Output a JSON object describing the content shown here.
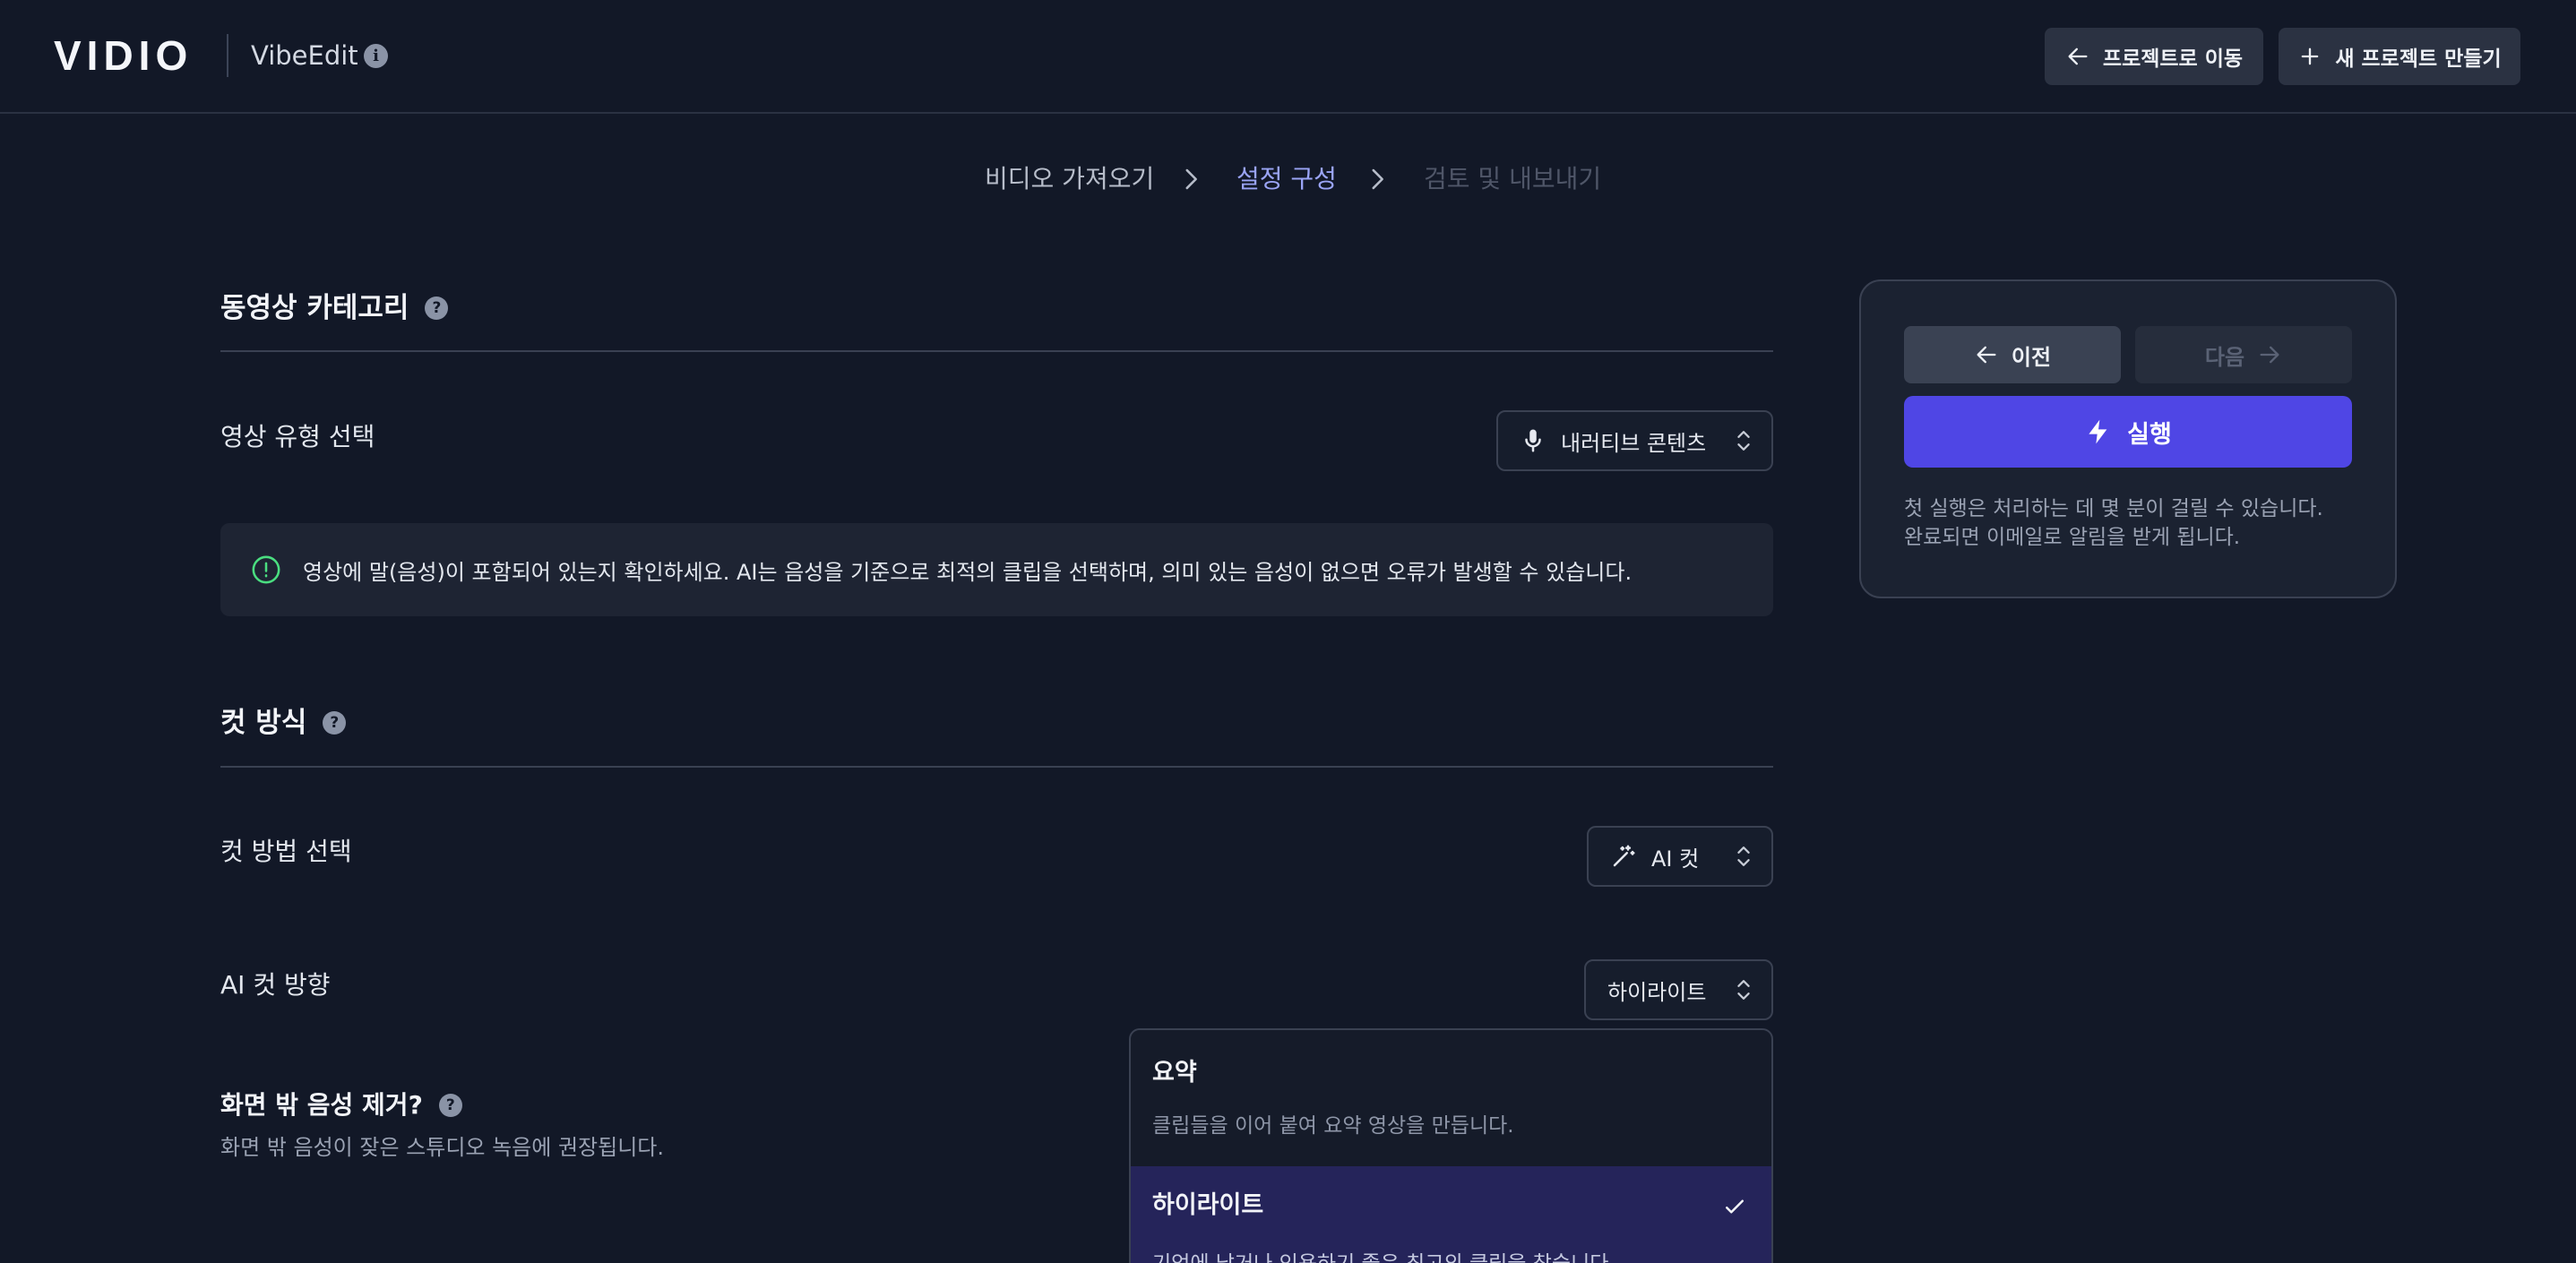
{
  "header": {
    "logo": "VIDIO",
    "product_name": "VibeEdit",
    "info_icon": "info-icon",
    "goto_projects_label": "프로젝트로 이동",
    "new_project_label": "새 프로젝트 만들기"
  },
  "stepper": {
    "steps": [
      {
        "label": "비디오 가져오기",
        "state": "done"
      },
      {
        "label": "설정 구성",
        "state": "active"
      },
      {
        "label": "검토 및 내보내기",
        "state": "upcoming"
      }
    ]
  },
  "category_section": {
    "title": "동영상 카테고리",
    "video_type_label": "영상 유형 선택",
    "video_type_value": "내러티브 콘텐츠",
    "video_type_icon": "microphone-icon",
    "notice": "영상에 말(음성)이 포함되어 있는지 확인하세요. AI는 음성을 기준으로 최적의 클립을 선택하며, 의미 있는 음성이 없으면 오류가 발생할 수 있습니다."
  },
  "cut_section": {
    "title": "컷 방식",
    "cut_method_label": "컷 방법 선택",
    "cut_method_value": "AI 컷",
    "cut_method_icon": "magic-wand-icon",
    "ai_direction_label": "AI 컷 방향",
    "ai_direction_value": "하이라이트",
    "offscreen_label": "화면 밖 음성 제거?",
    "offscreen_desc": "화면 밖 음성이 잦은 스튜디오 녹음에 권장됩니다."
  },
  "dropdown": {
    "options": [
      {
        "title": "요약",
        "desc": "클립들을 이어 붙여 요약 영상을 만듭니다.",
        "selected": false
      },
      {
        "title": "하이라이트",
        "desc": "기억에 남거나 인용하기 좋은 최고의 클립을 찾습니다.",
        "selected": true
      }
    ]
  },
  "panel": {
    "prev_label": "이전",
    "next_label": "다음",
    "run_label": "실행",
    "note_line1": "첫 실행은 처리하는 데 몇 분이 걸릴 수 있습니다.",
    "note_line2": "완료되면 이메일로 알림을 받게 됩니다."
  },
  "colors": {
    "background": "#121827",
    "accent": "#4f46e5",
    "active_step": "#9aa4f5",
    "selected_option": "#25245a"
  }
}
